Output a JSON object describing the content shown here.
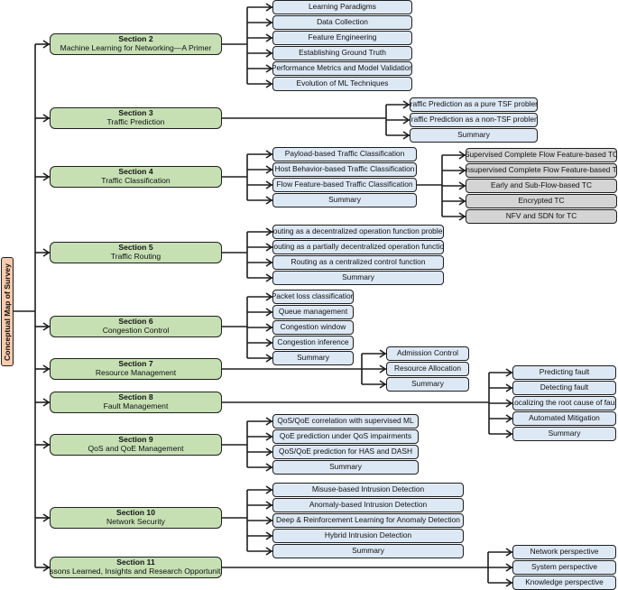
{
  "title": "Conceptual Map of Survey",
  "colors": {
    "root_fill": "#f8cbad",
    "section_fill": "#c6e0b4",
    "subsection_fill": "#dde8f5",
    "subsubsection_fill": "#d4d4d4",
    "line": "#1e1e1e"
  },
  "sections": [
    {
      "number": "Section 2",
      "title": "Machine Learning for Networking—A Primer",
      "children": [
        "Learning Paradigms",
        "Data Collection",
        "Feature Engineering",
        "Establishing Ground Truth",
        "Performance Metrics and Model Validation",
        "Evolution of ML Techniques"
      ]
    },
    {
      "number": "Section 3",
      "title": "Traffic Prediction",
      "children": [
        "Traffic Prediction as a pure TSF problem",
        "Traffic Prediction as a non-TSF problem",
        "Summary"
      ]
    },
    {
      "number": "Section 4",
      "title": "Traffic Classification",
      "children": [
        "Payload-based Traffic Classification",
        "Host Behavior-based Traffic Classification",
        "Flow Feature-based Traffic Classification",
        "Summary"
      ],
      "grandchildren_of": 2,
      "grandchildren": [
        "Supervised Complete Flow Feature-based TC",
        "Unsupervised Complete Flow Feature-based TC",
        "Early and Sub-Flow-based TC",
        "Encrypted TC",
        "NFV and SDN for TC"
      ]
    },
    {
      "number": "Section 5",
      "title": "Traffic Routing",
      "children": [
        "Routing as a decentralized operation function problem",
        "Routing as a partially decentralized operation function",
        "Routing as a centralized control function",
        "Summary"
      ]
    },
    {
      "number": "Section 6",
      "title": "Congestion Control",
      "children": [
        "Packet loss classification",
        "Queue management",
        "Congestion window",
        "Congestion inference",
        "Summary"
      ]
    },
    {
      "number": "Section 7",
      "title": "Resource Management",
      "children": [
        "Admission Control",
        "Resource Allocation",
        "Summary"
      ]
    },
    {
      "number": "Section 8",
      "title": "Fault Management",
      "children": [
        "Predicting fault",
        "Detecting fault",
        "Localizing the root cause of fault",
        "Automated Mitigation",
        "Summary"
      ]
    },
    {
      "number": "Section 9",
      "title": "QoS and QoE Management",
      "children": [
        "QoS/QoE correlation with supervised ML",
        "QoE prediction under QoS impairments",
        "QoS/QoE prediction for HAS and DASH",
        "Summary"
      ]
    },
    {
      "number": "Section 10",
      "title": "Network Security",
      "children": [
        "Misuse-based Intrusion Detection",
        "Anomaly-based Intrusion Detection",
        "Deep & Reinforcement Learning for Anomaly Detection",
        "Hybrid Intrusion Detection",
        "Summary"
      ]
    },
    {
      "number": "Section 11",
      "title": "Lessons Learned, Insights and Research Opportunities",
      "children": [
        "Network perspective",
        "System perspective",
        "Knowledge perspective"
      ]
    }
  ]
}
